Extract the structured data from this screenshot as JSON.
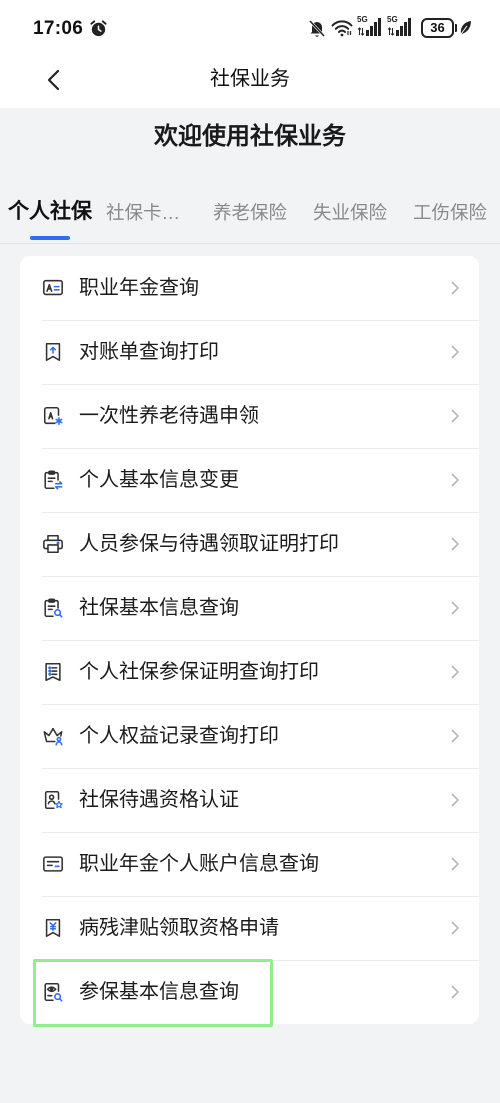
{
  "status_bar": {
    "time": "17:06",
    "signal_1": {
      "label": "5G",
      "icon": "signal-5g-icon"
    },
    "signal_2": {
      "label": "5G",
      "icon": "signal-5g-icon"
    },
    "battery": {
      "level": "36",
      "icon": "battery-icon"
    },
    "icons": [
      "alarm-icon",
      "mute-bell-icon",
      "wifi-icon",
      "leaf-icon"
    ]
  },
  "header": {
    "title": "社保业务",
    "back_icon": "back-arrow-icon"
  },
  "welcome_title": "欢迎使用社保业务",
  "tabs": [
    {
      "label": "个人社保",
      "active": true
    },
    {
      "label": "社保卡…",
      "active": false
    },
    {
      "label": "养老保险",
      "active": false
    },
    {
      "label": "失业保险",
      "active": false
    },
    {
      "label": "工伤保险",
      "active": false
    }
  ],
  "menu_items": [
    {
      "label": "职业年金查询",
      "icon": "id-card-icon"
    },
    {
      "label": "对账单查询打印",
      "icon": "statement-icon"
    },
    {
      "label": "一次性养老待遇申领",
      "icon": "pension-claim-icon"
    },
    {
      "label": "个人基本信息变更",
      "icon": "info-change-icon"
    },
    {
      "label": "人员参保与待遇领取证明打印",
      "icon": "printer-icon"
    },
    {
      "label": "社保基本信息查询",
      "icon": "info-query-icon"
    },
    {
      "label": "个人社保参保证明查询打印",
      "icon": "certificate-icon"
    },
    {
      "label": "个人权益记录查询打印",
      "icon": "rights-record-icon"
    },
    {
      "label": "社保待遇资格认证",
      "icon": "qualification-icon"
    },
    {
      "label": "职业年金个人账户信息查询",
      "icon": "account-card-icon"
    },
    {
      "label": "病残津贴领取资格申请",
      "icon": "allowance-icon"
    },
    {
      "label": "参保基本信息查询",
      "icon": "insurance-query-icon"
    }
  ],
  "item_chevron_icon": "chevron-right-icon",
  "colors": {
    "accent": "#2f6ef2",
    "highlight": "#93ec8e",
    "background": "#f2f3f5",
    "card": "#ffffff",
    "text": "#1b1b1b",
    "tab_inactive": "#8a8a8a"
  }
}
